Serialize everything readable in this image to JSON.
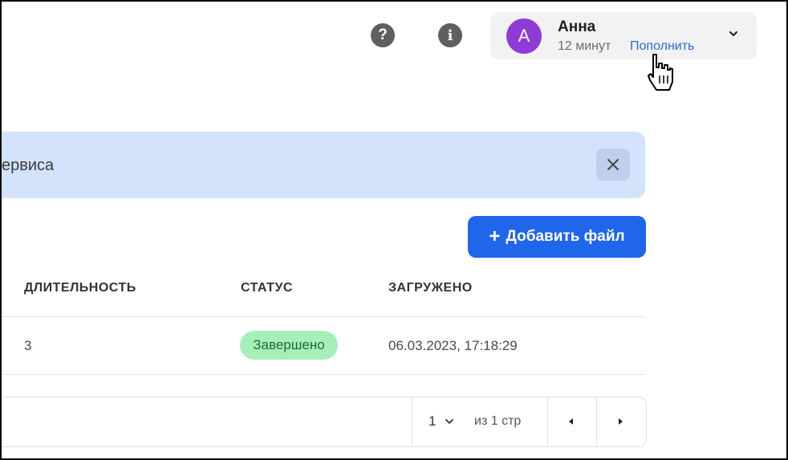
{
  "header": {
    "help_icon": "question-circle-icon",
    "help_glyph": "?",
    "info_icon": "info-circle-icon",
    "info_glyph": "i",
    "user": {
      "avatar_letter": "А",
      "avatar_color": "#8e3bd8",
      "name": "Анна",
      "time_left": "12 минут",
      "topup_label": "Пополнить"
    }
  },
  "banner": {
    "text": "ервиса",
    "background": "#d3e3fc"
  },
  "toolbar": {
    "add_plus": "+",
    "add_file_label": "Добавить файл",
    "accent": "#1f66ea"
  },
  "table": {
    "columns": [
      "ДЛИТЕЛЬНОСТЬ",
      "СТАТУС",
      "ЗАГРУЖЕНО"
    ],
    "rows": [
      {
        "duration": "3",
        "status": "Завершено",
        "uploaded": "06.03.2023, 17:18:29"
      }
    ],
    "status_color": "#a6efb9"
  },
  "pagination": {
    "current_page": "1",
    "of_pages": "из 1 стр"
  }
}
